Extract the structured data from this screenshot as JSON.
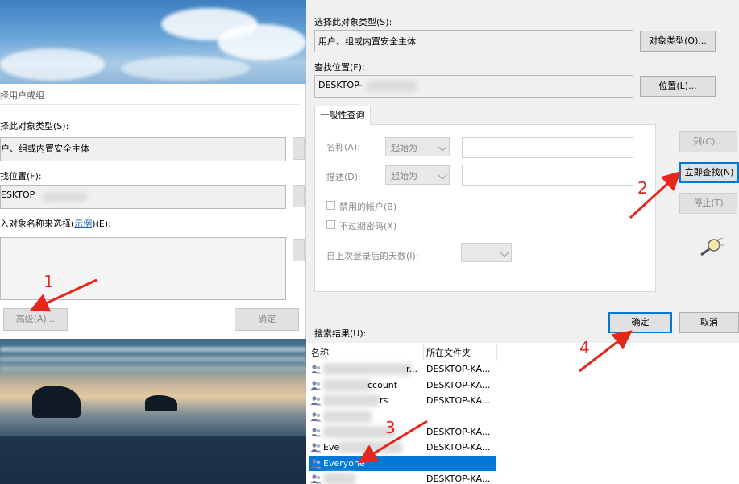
{
  "back_dialog": {
    "title": "择用户或组",
    "object_type_label": "择此对象类型(S):",
    "object_type_value": "户、组或内置安全主体",
    "location_label": "找位置(F):",
    "location_value": "ESKTOP",
    "enter_label_pre": "入对象名称来选择(",
    "enter_label_link": "示例",
    "enter_label_post": ")(E):",
    "advanced_button": "高级(A)...",
    "ok_button": "确定"
  },
  "front_dialog": {
    "object_type_label": "选择此对象类型(S):",
    "object_type_value": "用户、组或内置安全主体",
    "object_type_button": "对象类型(O)...",
    "location_label": "查找位置(F):",
    "location_value": "DESKTOP-",
    "location_button": "位置(L)...",
    "common_query_tab": "一般性查询",
    "name_label": "名称(A):",
    "name_combo": "起始为",
    "desc_label": "描述(D):",
    "desc_combo": "起始为",
    "disabled_accounts": "禁用的帐户(B)",
    "non_expiring_pw": "不过期密码(X)",
    "days_since_login": "自上次登录后的天数(I):",
    "columns_button": "列(C)...",
    "find_now_button": "立即查找(N)",
    "stop_button": "停止(T)",
    "ok_button": "确定",
    "cancel_button": "取消",
    "results_label": "搜索结果(U):",
    "col_name": "名称",
    "col_folder": "所在文件夹",
    "rows": [
      {
        "name": "r...",
        "folder": "DESKTOP-KA..."
      },
      {
        "name": "ccount",
        "folder": "DESKTOP-KA..."
      },
      {
        "name": "rs",
        "folder": "DESKTOP-KA..."
      },
      {
        "name": "",
        "folder": ""
      },
      {
        "name": "",
        "folder": "DESKTOP-KA..."
      },
      {
        "name": "Eve",
        "folder": "DESKTOP-KA..."
      },
      {
        "name": "Everyone",
        "folder": ""
      },
      {
        "name": "",
        "folder": "DESKTOP-KA..."
      }
    ]
  },
  "annotations": [
    "1",
    "2",
    "3",
    "4"
  ],
  "colors": {
    "annotation": "#e5261c",
    "selection": "#0078d7"
  }
}
